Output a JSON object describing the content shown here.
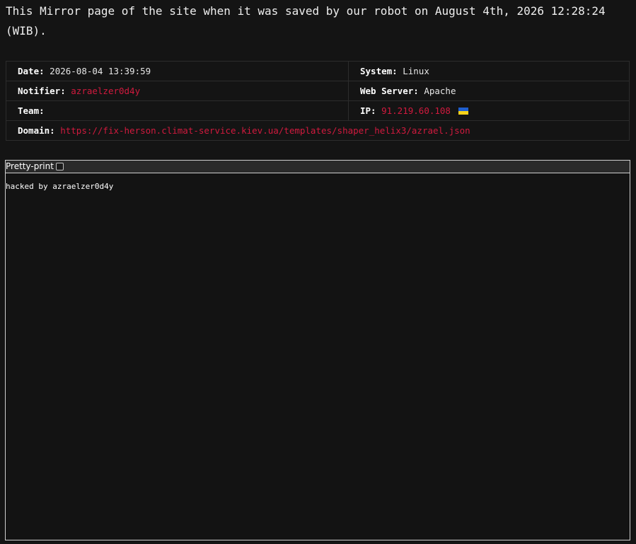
{
  "notice": {
    "text": "This Mirror page of the site when it was saved by our robot on August 4th, 2026 12:28:24 (WIB)."
  },
  "info": {
    "date_label": "Date:",
    "date_value": "2026-08-04 13:39:59",
    "system_label": "System:",
    "system_value": "Linux",
    "notifier_label": "Notifier:",
    "notifier_value": "azraelzer0d4y",
    "webserver_label": "Web Server:",
    "webserver_value": "Apache",
    "team_label": "Team:",
    "team_value": "",
    "ip_label": "IP:",
    "ip_value": "91.219.60.108",
    "ip_flag_icon": "ukraine-flag-icon",
    "domain_label": "Domain:",
    "domain_value": "https://fix-herson.climat-service.kiev.ua/templates/shaper_helix3/azrael.json"
  },
  "viewer": {
    "pretty_print_label": "Pretty-print",
    "pretty_print_checked": false,
    "content": "hacked by azraelzer0d4y"
  },
  "colors": {
    "background": "#141414",
    "accent_red": "#d11a3e",
    "border": "#2c2c2c"
  }
}
